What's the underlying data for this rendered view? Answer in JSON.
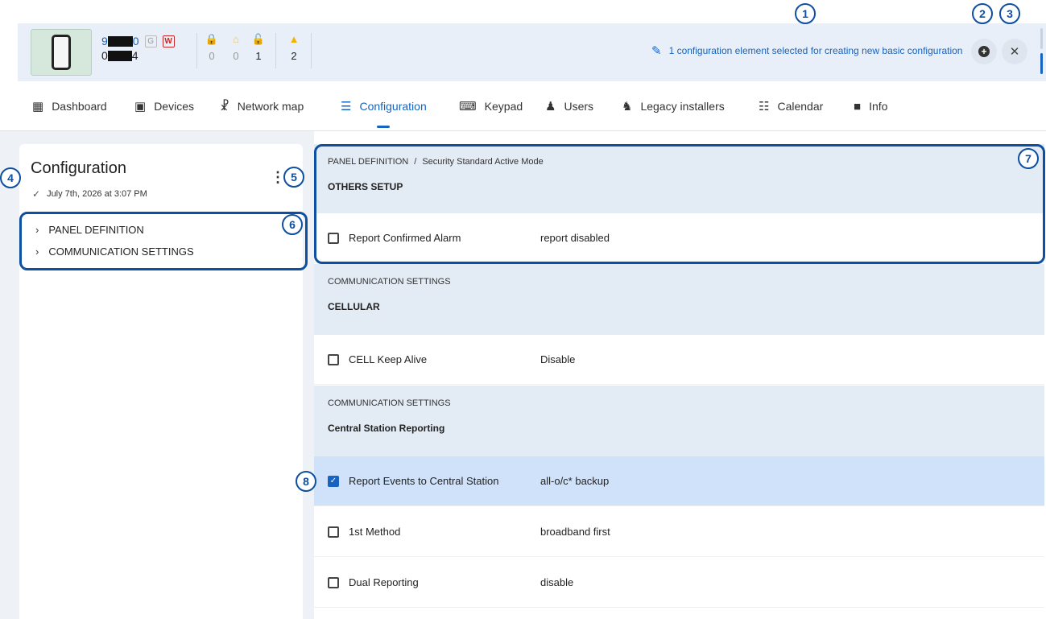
{
  "header": {
    "device_id_prefix": "9",
    "device_id_suffix": "0",
    "device_line2_prefix": "0",
    "device_line2_suffix": "4",
    "badge_g": "G",
    "badge_w": "W",
    "stats": [
      {
        "icon": "lock-red-icon",
        "color": "#e57373",
        "value": "0"
      },
      {
        "icon": "home-lock-icon",
        "color": "#f0c05a",
        "value": "0"
      },
      {
        "icon": "unlock-icon",
        "color": "#2e7d32",
        "value": "1"
      },
      {
        "icon": "warning-icon",
        "color": "#f2b300",
        "value": "2"
      }
    ],
    "notice": "1 configuration element selected for creating new basic configuration"
  },
  "nav": {
    "tabs": [
      {
        "label": "Dashboard"
      },
      {
        "label": "Devices"
      },
      {
        "label": "Network map"
      },
      {
        "label": "Configuration"
      },
      {
        "label": "Keypad"
      },
      {
        "label": "Users"
      },
      {
        "label": "Legacy installers"
      },
      {
        "label": "Calendar"
      },
      {
        "label": "Info"
      }
    ],
    "active": "Configuration"
  },
  "left": {
    "title": "Configuration",
    "date": "July 7th, 2026 at 3:07 PM",
    "tree": [
      "PANEL DEFINITION",
      "COMMUNICATION SETTINGS"
    ]
  },
  "sections": [
    {
      "path_1": "PANEL DEFINITION",
      "path_2": "Security Standard Active Mode",
      "title": "OTHERS SETUP",
      "rows": [
        {
          "name": "Report Confirmed Alarm",
          "value": "report disabled",
          "checked": false
        }
      ]
    },
    {
      "path_1": "COMMUNICATION SETTINGS",
      "title": "CELLULAR",
      "rows": [
        {
          "name": "CELL Keep Alive",
          "value": "Disable",
          "checked": false
        }
      ]
    },
    {
      "path_1": "COMMUNICATION SETTINGS",
      "title": "Central Station Reporting",
      "rows": [
        {
          "name": "Report Events to Central Station",
          "value": "all-o/c* backup",
          "checked": true
        },
        {
          "name": "1st Method",
          "value": "broadband first",
          "checked": false
        },
        {
          "name": "Dual Reporting",
          "value": "disable",
          "checked": false
        }
      ]
    }
  ],
  "callouts": [
    "1",
    "2",
    "3",
    "4",
    "5",
    "6",
    "7",
    "8"
  ],
  "colors": {
    "accent": "#1664c0",
    "callout": "#0d4fa0",
    "header_bg": "#e9eff8",
    "selected_row": "#cfe2fa"
  }
}
